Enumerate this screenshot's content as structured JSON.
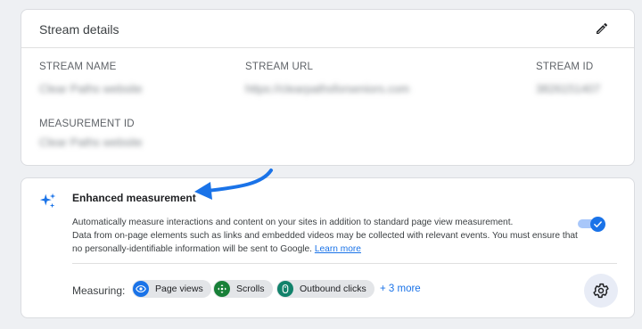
{
  "stream_details": {
    "title": "Stream details",
    "edit_icon": "pencil-icon",
    "fields": {
      "stream_name": {
        "label": "STREAM NAME",
        "value": "Clear Paths website"
      },
      "stream_url": {
        "label": "STREAM URL",
        "value": "https://clearpathsforseniors.com"
      },
      "stream_id": {
        "label": "STREAM ID",
        "value": "3826151407"
      },
      "measurement_id": {
        "label": "MEASUREMENT ID",
        "value": "Clear Paths website"
      }
    }
  },
  "enhanced": {
    "icon": "sparkle-icon",
    "title": "Enhanced measurement",
    "desc_line1": "Automatically measure interactions and content on your sites in addition to standard page view measurement.",
    "desc_line2": "Data from on-page elements such as links and embedded videos may be collected with relevant events. You must ensure that no personally-identifiable information will be sent to Google.",
    "learn_more": "Learn more",
    "toggle_on": true,
    "measuring_label": "Measuring:",
    "chips": [
      {
        "label": "Page views",
        "icon": "eye-icon",
        "color": "#1a73e8"
      },
      {
        "label": "Scrolls",
        "icon": "scroll-crosshair-icon",
        "color": "#188038"
      },
      {
        "label": "Outbound clicks",
        "icon": "mouse-icon",
        "color": "#12826b"
      }
    ],
    "more_label": "+ 3 more",
    "settings_icon": "gear-icon"
  },
  "colors": {
    "accent": "#1a73e8",
    "arrow": "#1a73e8"
  }
}
